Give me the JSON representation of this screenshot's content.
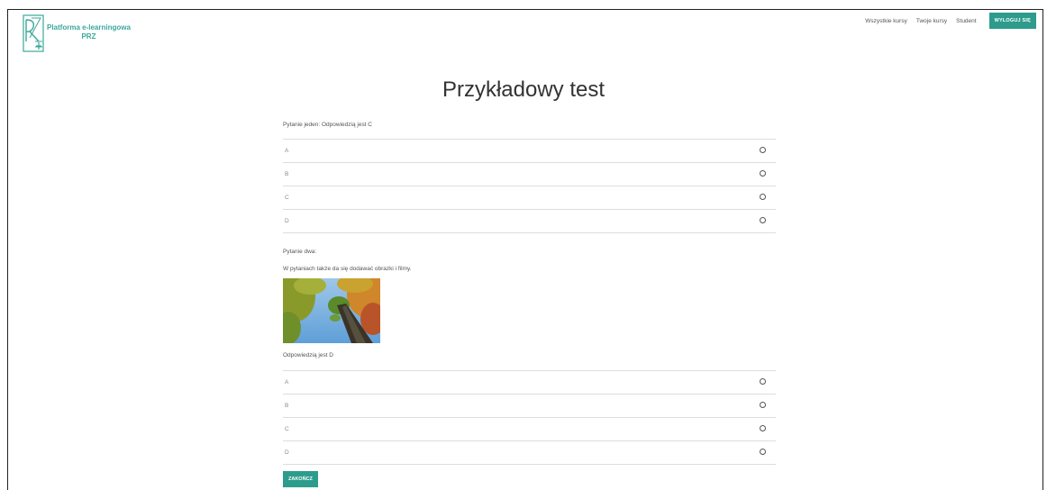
{
  "header": {
    "logo_line1": "Platforma e-learningowa",
    "logo_line2": "PRZ",
    "nav": [
      "Wszystkie kursy",
      "Twoje kursy",
      "Student"
    ],
    "logout_label": "WYLOGUJ SIĘ"
  },
  "page": {
    "title": "Przykładowy test"
  },
  "question1": {
    "text": "Pytanie jeden: Odpowiedzią jest  C",
    "options": [
      "A",
      "B",
      "C",
      "D"
    ]
  },
  "question2": {
    "title": "Pytanie dwa:",
    "text": "W pytaniach także da się dodawać obrazki i filmy.",
    "image": "tree-photo",
    "answer_text": "Odpowiedzią jest D",
    "options": [
      "A",
      "B",
      "C",
      "D"
    ]
  },
  "footer": {
    "finish_label": "ZAKOŃCZ"
  },
  "colors": {
    "accent": "#2d9c8c",
    "logo": "#3aa89a"
  }
}
